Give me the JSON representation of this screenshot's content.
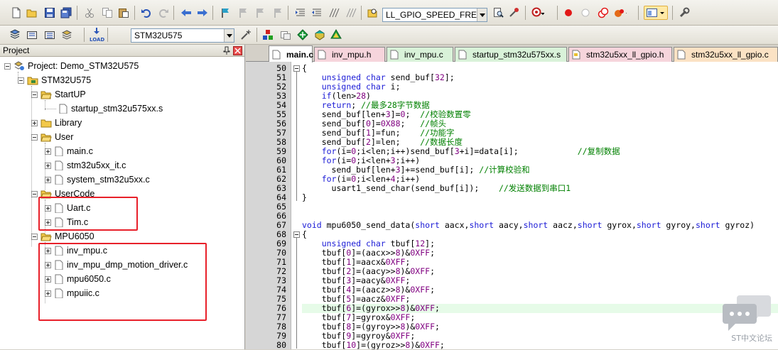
{
  "toolbar1": {
    "define_combo": "LL_GPIO_SPEED_FREQ_LC",
    "icons": [
      "new-file-icon",
      "open-icon",
      "save-icon",
      "save-all-icon",
      "cut-icon",
      "copy-icon",
      "paste-icon",
      "undo-icon",
      "redo-icon",
      "back-icon",
      "forward-icon",
      "bookmark-icon",
      "prev-bookmark-icon",
      "next-bookmark-icon",
      "clear-bookmarks-icon",
      "indent-icon",
      "unindent-icon",
      "comment-icon",
      "uncomment-icon",
      "find-in-files-icon",
      "find-icon",
      "debug-start-icon",
      "breakpoint-icon",
      "disable-breakpoint-icon",
      "kill-breakpoints-icon",
      "window-layout-icon",
      "configure-icon"
    ]
  },
  "toolbar2": {
    "target_combo": "STM32U575",
    "load_label": "LOAD"
  },
  "project_pane": {
    "title": "Project",
    "tree": {
      "project": "Project: Demo_STM32U575",
      "target": "STM32U575",
      "groups": [
        {
          "name": "StartUP",
          "files": [
            "startup_stm32u575xx.s"
          ]
        },
        {
          "name": "Library",
          "files": []
        },
        {
          "name": "User",
          "files": [
            "main.c",
            "stm32u5xx_it.c",
            "system_stm32u5xx.c"
          ]
        },
        {
          "name": "UserCode",
          "files": [
            "Uart.c",
            "Tim.c"
          ]
        },
        {
          "name": "MPU6050",
          "files": [
            "inv_mpu.c",
            "inv_mpu_dmp_motion_driver.c",
            "mpu6050.c",
            "mpuiic.c"
          ]
        }
      ]
    }
  },
  "tabs": [
    {
      "label": "main.c",
      "color": "#ffffff",
      "active": true
    },
    {
      "label": "inv_mpu.h",
      "color": "#f6d5dc"
    },
    {
      "label": "inv_mpu.c",
      "color": "#d9f2d9"
    },
    {
      "label": "startup_stm32u575xx.s",
      "color": "#d9f2d9"
    },
    {
      "label": "stm32u5xx_ll_gpio.h",
      "color": "#f6d5dc"
    },
    {
      "label": "stm32u5xx_ll_gpio.c",
      "color": "#fbe2c4"
    }
  ],
  "code": {
    "first_line": 50,
    "current_line": 76,
    "lines": [
      "{",
      "    unsigned char send_buf[32];",
      "    unsigned char i;",
      "    if(len>28)",
      "    return; //最多28字节数据",
      "    send_buf[len+3]=0;  //校验数置零",
      "    send_buf[0]=0X88;   //帧头",
      "    send_buf[1]=fun;    //功能字",
      "    send_buf[2]=len;    //数据长度",
      "    for(i=0;i<len;i++)send_buf[3+i]=data[i];            //复制数据",
      "    for(i=0;i<len+3;i++)",
      "      send_buf[len+3]+=send_buf[i]; //计算校验和",
      "    for(i=0;i<len+4;i++)",
      "      usart1_send_char(send_buf[i]);    //发送数据到串口1",
      "}",
      "",
      "",
      "void mpu6050_send_data(short aacx,short aacy,short aacz,short gyrox,short gyroy,short gyroz)",
      "{",
      "    unsigned char tbuf[12];",
      "    tbuf[0]=(aacx>>8)&0XFF;",
      "    tbuf[1]=aacx&0XFF;",
      "    tbuf[2]=(aacy>>8)&0XFF;",
      "    tbuf[3]=aacy&0XFF;",
      "    tbuf[4]=(aacz>>8)&0XFF;",
      "    tbuf[5]=aacz&0XFF;",
      "    tbuf[6]=(gyrox>>8)&0XFF;",
      "    tbuf[7]=gyrox&0XFF;",
      "    tbuf[8]=(gyroy>>8)&0XFF;",
      "    tbuf[9]=gyroy&0XFF;",
      "    tbuf[10]=(gyroz>>8)&0XFF;"
    ]
  },
  "watermark": "ST中文论坛"
}
